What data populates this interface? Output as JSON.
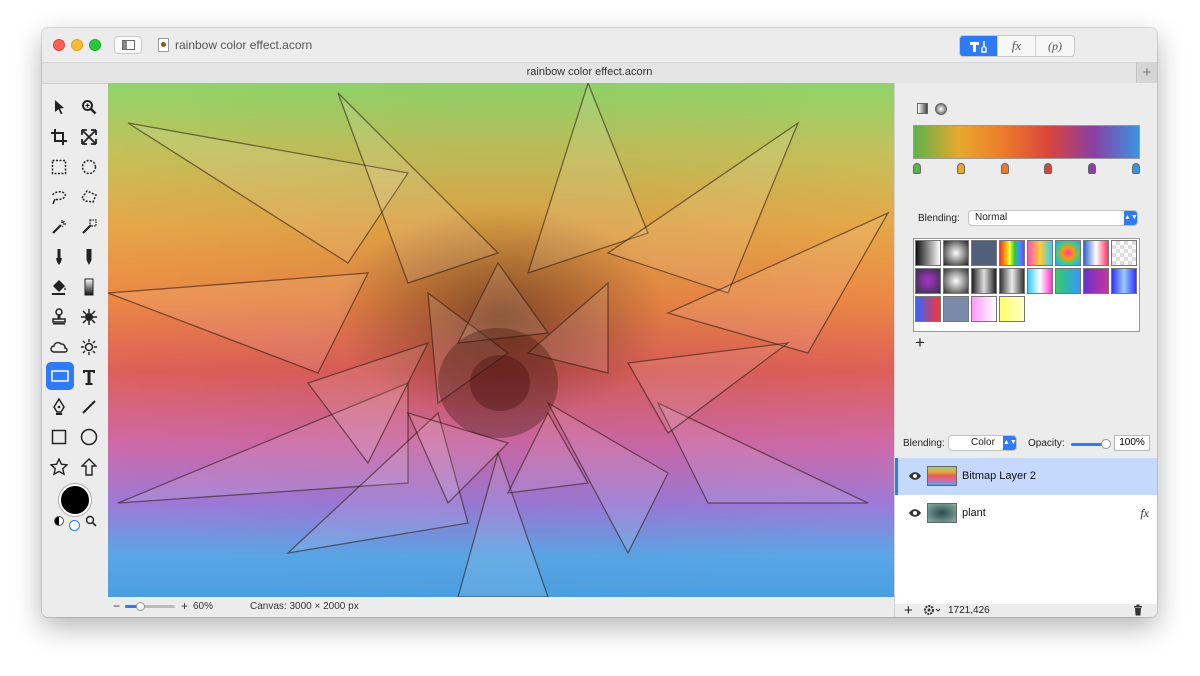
{
  "window": {
    "title": "rainbow color effect.acorn",
    "tab_title": "rainbow color effect.acorn",
    "tab_add": "+"
  },
  "toolbar_segments": [
    {
      "name": "tools-palette",
      "label": "",
      "active": true
    },
    {
      "name": "effects-palette",
      "label": "fx",
      "active": false
    },
    {
      "name": "properties-palette",
      "label": "(p)",
      "active": false
    }
  ],
  "tools": [
    "arrow-tool-icon",
    "zoom-tool-icon",
    "crop-tool-icon",
    "transform-tool-icon",
    "rect-select-icon",
    "ellipse-select-icon",
    "lasso-icon",
    "polygon-lasso-icon",
    "magic-wand-icon",
    "magic-select-icon",
    "brush-icon",
    "pencil-icon",
    "paint-bucket-icon",
    "gradient-tool-icon",
    "clone-stamp-icon",
    "smudge-icon",
    "shape-cloud-icon",
    "dodge-burn-icon",
    "gradient-rect-icon",
    "text-tool-icon",
    "pen-tool-icon",
    "line-tool-icon",
    "rect-shape-icon",
    "oval-shape-icon",
    "star-shape-icon",
    "arrow-shape-icon"
  ],
  "status": {
    "zoom_minus": "−",
    "zoom_plus": "+",
    "zoom_level": "60%",
    "zoom_fraction": 0.3,
    "canvas_size": "Canvas: 3000 × 2000 px"
  },
  "gradient": {
    "blending_label": "Blending:",
    "blending_value": "Normal",
    "add_label": "+",
    "stops": [
      {
        "color": "#5fb14a",
        "position": 0.0
      },
      {
        "color": "#e8a82c",
        "position": 0.2
      },
      {
        "color": "#ec7a2a",
        "position": 0.4
      },
      {
        "color": "#d8453e",
        "position": 0.6
      },
      {
        "color": "#8a3fa6",
        "position": 0.8
      },
      {
        "color": "#3a94e0",
        "position": 1.0
      }
    ]
  },
  "layers": {
    "blending_label": "Blending:",
    "blending_value": "Color",
    "opacity_label": "Opacity:",
    "opacity_value": "100%",
    "opacity_fraction": 1.0,
    "items": [
      {
        "name": "Bitmap Layer 2",
        "selected": true,
        "fx": ""
      },
      {
        "name": "plant",
        "selected": false,
        "fx": "fx"
      }
    ],
    "footer_coords": "1721,426",
    "footer_add": "+"
  },
  "colors": {
    "accent": "#2f7bf5",
    "selected_row": "#c4d9fb"
  }
}
